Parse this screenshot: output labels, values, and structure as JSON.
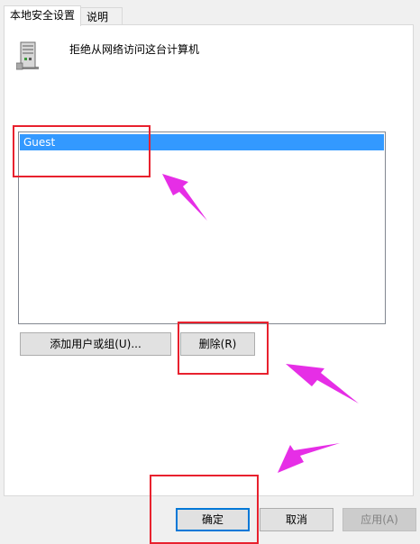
{
  "tabs": [
    {
      "label": "本地安全设置",
      "active": true
    },
    {
      "label": "说明",
      "active": false
    }
  ],
  "policy": {
    "title": "拒绝从网络访问这台计算机",
    "icon": "server-computer-icon"
  },
  "account_list": {
    "items": [
      {
        "label": "Guest",
        "selected": true
      }
    ]
  },
  "buttons": {
    "add_user_or_group": "添加用户或组(U)...",
    "remove": "删除(R)",
    "ok": "确定",
    "cancel": "取消",
    "apply": "应用(A)"
  },
  "annotations": {
    "box_color": "#e8212e",
    "arrow_color": "#e62ee6"
  },
  "colors": {
    "selection": "#3399ff",
    "default_button_border": "#0078d7"
  }
}
